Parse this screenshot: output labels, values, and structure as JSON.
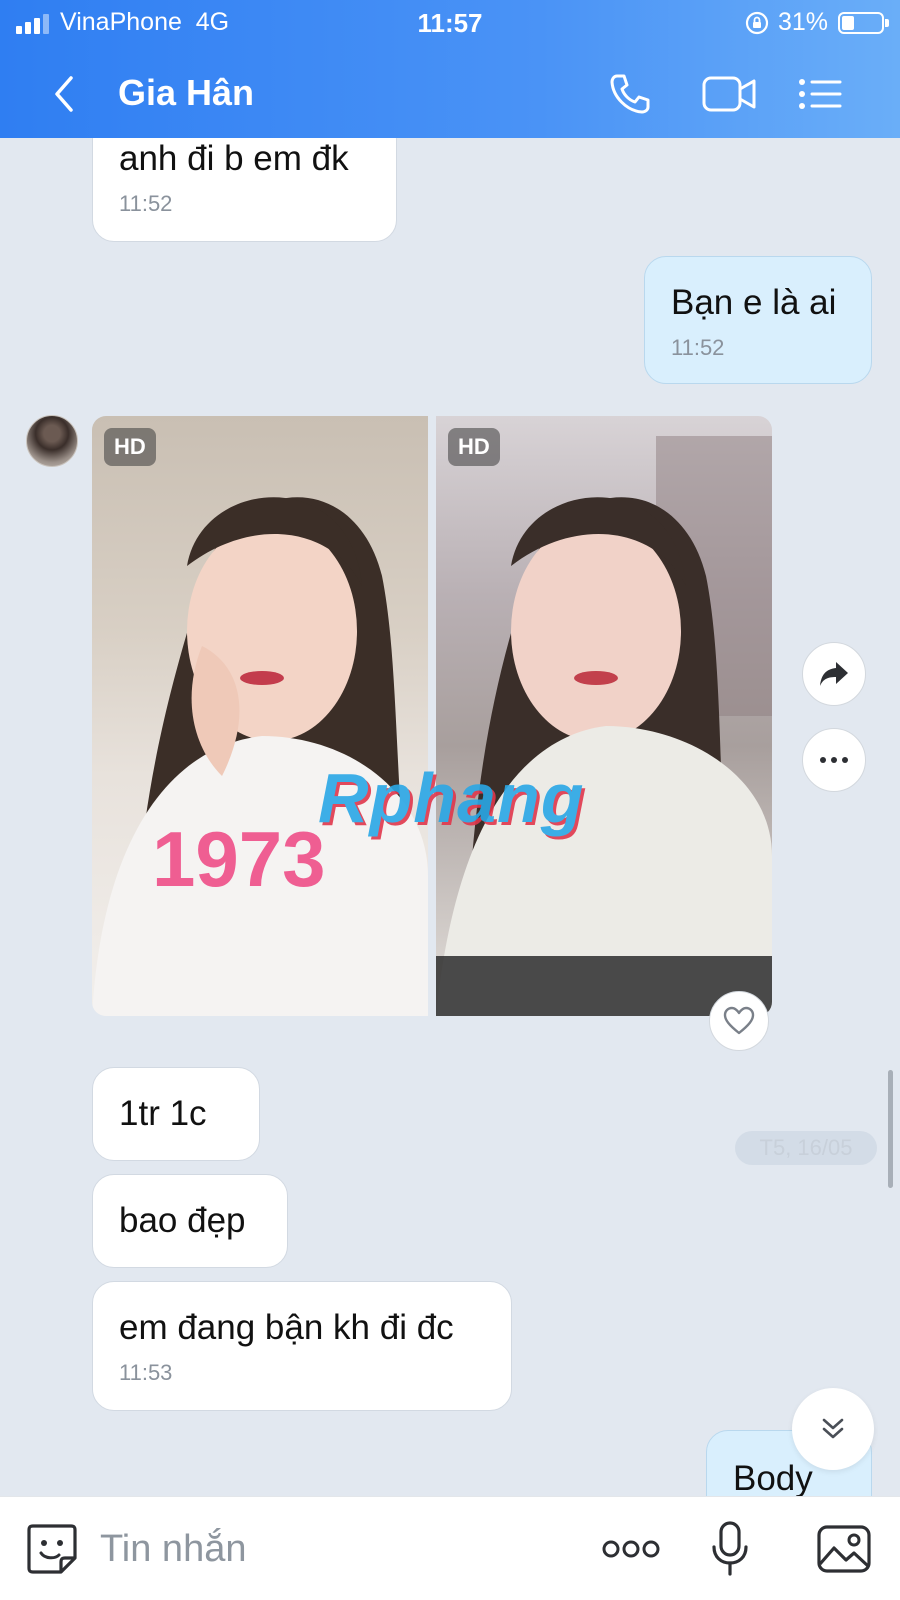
{
  "status_bar": {
    "carrier": "VinaPhone",
    "network": "4G",
    "time": "11:57",
    "battery_percent": "31%",
    "battery_level": 0.31
  },
  "header": {
    "contact_name": "Gia Hân",
    "icons": [
      "back-icon",
      "phone-icon",
      "video-icon",
      "menu-icon"
    ]
  },
  "messages": [
    {
      "direction": "in",
      "text": "anh đi b em đk",
      "time": "11:52"
    },
    {
      "direction": "out",
      "text": "Bạn e là ai",
      "time": "11:52"
    },
    {
      "direction": "in",
      "type": "photos",
      "badges": [
        "HD",
        "HD"
      ],
      "watermark": "Rphang"
    },
    {
      "direction": "in",
      "text": "1tr 1c"
    },
    {
      "direction": "in",
      "text": "bao đẹp"
    },
    {
      "direction": "in",
      "text": "em đang bận kh đi đc",
      "time": "11:53"
    },
    {
      "direction": "out",
      "text": "Body"
    }
  ],
  "date_separator": "T5, 16/05",
  "input_bar": {
    "placeholder": "Tin nhắn",
    "icons": [
      "sticker-icon",
      "more-icon",
      "mic-icon",
      "image-icon"
    ]
  },
  "colors": {
    "header_start": "#2f7ef2",
    "header_end": "#6aaef8",
    "chat_background": "#e2e8f0",
    "outgoing_bubble": "#d9effd",
    "incoming_bubble": "#ffffff"
  }
}
